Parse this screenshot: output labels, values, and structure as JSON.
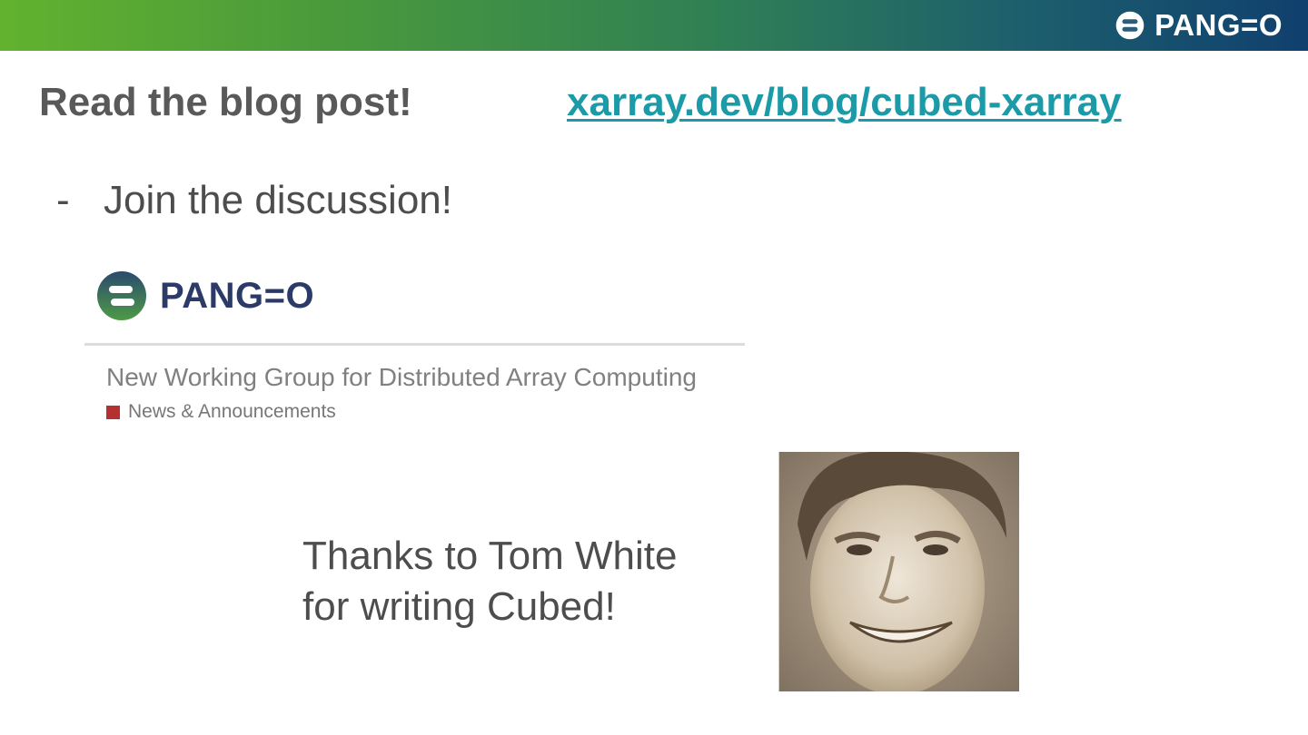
{
  "header": {
    "logo_text": "PANG=O",
    "colors": {
      "gradient_start": "#62b22f",
      "gradient_end": "#10406e"
    }
  },
  "slide": {
    "heading": "Read the blog post!",
    "link_text": "xarray.dev/blog/cubed-xarray",
    "link_color": "#1b9aa8",
    "bullet_marker": "-",
    "bullet_text": "Join the discussion!"
  },
  "forum": {
    "logo_text": "PANG=O",
    "topic_title": "New Working Group for Distributed Array Computing",
    "category": "News & Announcements",
    "category_color": "#b5312f"
  },
  "thanks": {
    "line1": "Thanks to Tom White",
    "line2": "for writing Cubed!"
  },
  "photo": {
    "icon": "portrait-photo"
  }
}
